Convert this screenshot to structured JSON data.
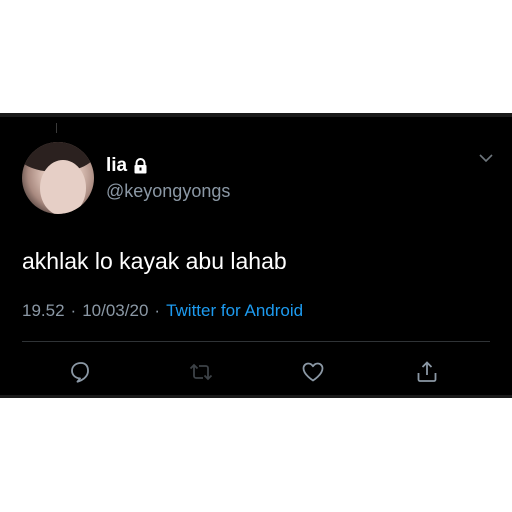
{
  "tweet": {
    "display_name": "lia",
    "handle": "@keyongyongs",
    "text": "akhlak lo kayak abu lahab",
    "time": "19.52",
    "date": "10/03/20",
    "separator": "·",
    "source": "Twitter for Android",
    "protected": true
  },
  "actions": {
    "reply_icon": "reply-icon",
    "retweet_icon": "retweet-icon",
    "like_icon": "heart-icon",
    "share_icon": "share-icon"
  },
  "colors": {
    "background": "#000000",
    "text": "#ffffff",
    "muted": "#8b98a5",
    "link": "#1d9bf0"
  }
}
